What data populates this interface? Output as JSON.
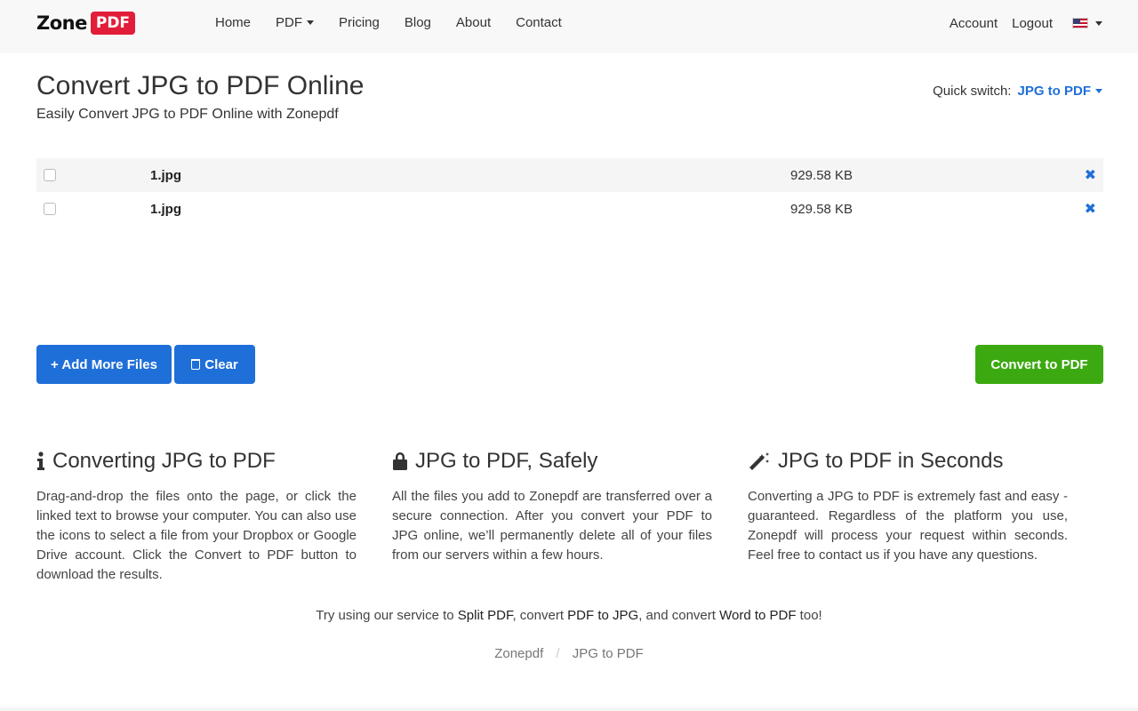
{
  "header": {
    "logo_text": "Zone",
    "logo_badge": "PDF",
    "nav": [
      {
        "label": "Home"
      },
      {
        "label": "PDF"
      },
      {
        "label": "Pricing"
      },
      {
        "label": "Blog"
      },
      {
        "label": "About"
      },
      {
        "label": "Contact"
      }
    ],
    "account_label": "Account",
    "logout_label": "Logout"
  },
  "page": {
    "title": "Convert JPG to PDF Online",
    "subtitle": "Easily Convert JPG to PDF Online with Zonepdf",
    "quick_switch_label": "Quick switch:",
    "quick_switch_value": "JPG to PDF"
  },
  "files": [
    {
      "name": "1.jpg",
      "size": "929.58 KB",
      "remove": "✖"
    },
    {
      "name": "1.jpg",
      "size": "929.58 KB",
      "remove": "✖"
    }
  ],
  "buttons": {
    "add": "+ Add More Files",
    "clear": "Clear",
    "convert": "Convert to PDF"
  },
  "features": [
    {
      "title": "Converting JPG to PDF",
      "text": "Drag-and-drop the files onto the page, or click the linked text to browse your computer. You can also use the icons to select a file from your Dropbox or Google Drive account. Click the Convert to PDF button to download the results."
    },
    {
      "title": "JPG to PDF, Safely",
      "text": "All the files you add to Zonepdf are transferred over a secure connection. After you convert your PDF to JPG online, we’ll permanently delete all of your files from our servers within a few hours."
    },
    {
      "title": "JPG to PDF in Seconds",
      "text": "Converting a JPG to PDF is extremely fast and easy - guaranteed. Regardless of the platform you use, Zonepdf will process your request within seconds. Feel free to contact us if you have any questions."
    }
  ],
  "cta": {
    "prefix": "Try using our service to ",
    "link1": "Split PDF",
    "mid1": ", convert ",
    "link2": "PDF to JPG",
    "mid2": ", and convert ",
    "link3": "Word to PDF",
    "suffix": " too!"
  },
  "breadcrumb": {
    "home": "Zonepdf",
    "separator": "/",
    "current": "JPG to PDF"
  },
  "colors": {
    "primary": "#1f6fd8",
    "success": "#3da911",
    "brand": "#e21d3a"
  }
}
